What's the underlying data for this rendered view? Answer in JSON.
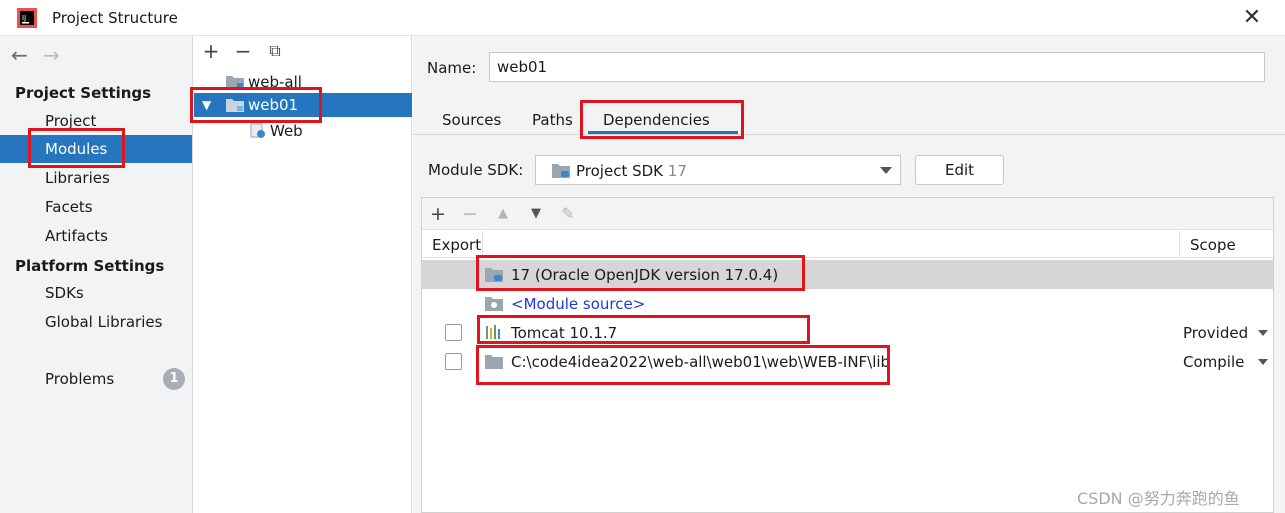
{
  "window": {
    "title": "Project Structure"
  },
  "sidebar": {
    "project_settings_heading": "Project Settings",
    "project_items": [
      "Project",
      "Modules",
      "Libraries",
      "Facets",
      "Artifacts"
    ],
    "platform_settings_heading": "Platform Settings",
    "platform_items": [
      "SDKs",
      "Global Libraries"
    ],
    "problems_label": "Problems",
    "problems_count": "1"
  },
  "tree": {
    "items": [
      "web-all",
      "web01",
      "Web"
    ]
  },
  "main": {
    "name_label": "Name:",
    "name_value": "web01",
    "tabs": [
      "Sources",
      "Paths",
      "Dependencies"
    ],
    "module_sdk_label": "Module SDK:",
    "module_sdk_value": "Project SDK",
    "module_sdk_version": "17",
    "edit_label": "Edit",
    "columns": {
      "export": "Export",
      "scope": "Scope"
    },
    "dependencies": [
      {
        "name": "17 (Oracle OpenJDK version 17.0.4)",
        "scope": ""
      },
      {
        "name": "<Module source>",
        "scope": ""
      },
      {
        "name": "Tomcat 10.1.7",
        "scope": "Provided"
      },
      {
        "name": "C:\\code4idea2022\\web-all\\web01\\web\\WEB-INF\\lib",
        "scope": "Compile"
      }
    ]
  },
  "watermark": "CSDN @努力奔跑的鱼",
  "colors": {
    "selection": "#2675bf",
    "highlight_box": "#e0141c"
  }
}
